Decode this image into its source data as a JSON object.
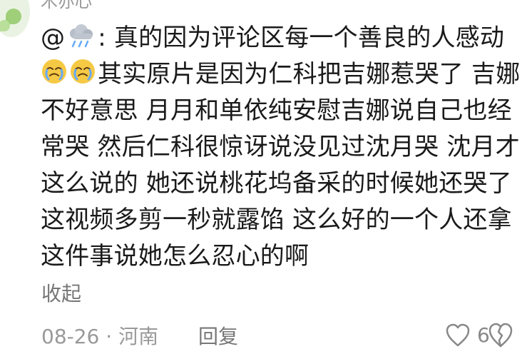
{
  "user": {
    "name_partial": "木亦心"
  },
  "comment": {
    "mention_prefix": "@",
    "mention_suffix": ":",
    "line_1": "真的因为评论区每一个善良的人感动",
    "text": "其实原片是因为仁科把吉娜惹哭了 吉娜不好意思 月月和单依纯安慰吉娜说自己也经常哭 然后仁科很惊讶说没见过沈月哭 沈月才这么说的 她还说桃花坞备采的时候她还哭了 这视频多剪一秒就露馅 这么好的一个人还拿这件事说她怎么忍心的啊",
    "mention_icon": "rain-cloud-icon",
    "emoji_icon": "crying-face-icon"
  },
  "actions": {
    "collapse_label": "收起",
    "reply_label": "回复"
  },
  "meta": {
    "date": "08-26",
    "separator": "·",
    "location": "河南"
  },
  "likes": {
    "count": "6"
  },
  "colors": {
    "text": "#1a1a1a",
    "muted": "#999999",
    "secondary": "#777777",
    "emoji": "#f6c945",
    "tear": "#67aaf8"
  }
}
